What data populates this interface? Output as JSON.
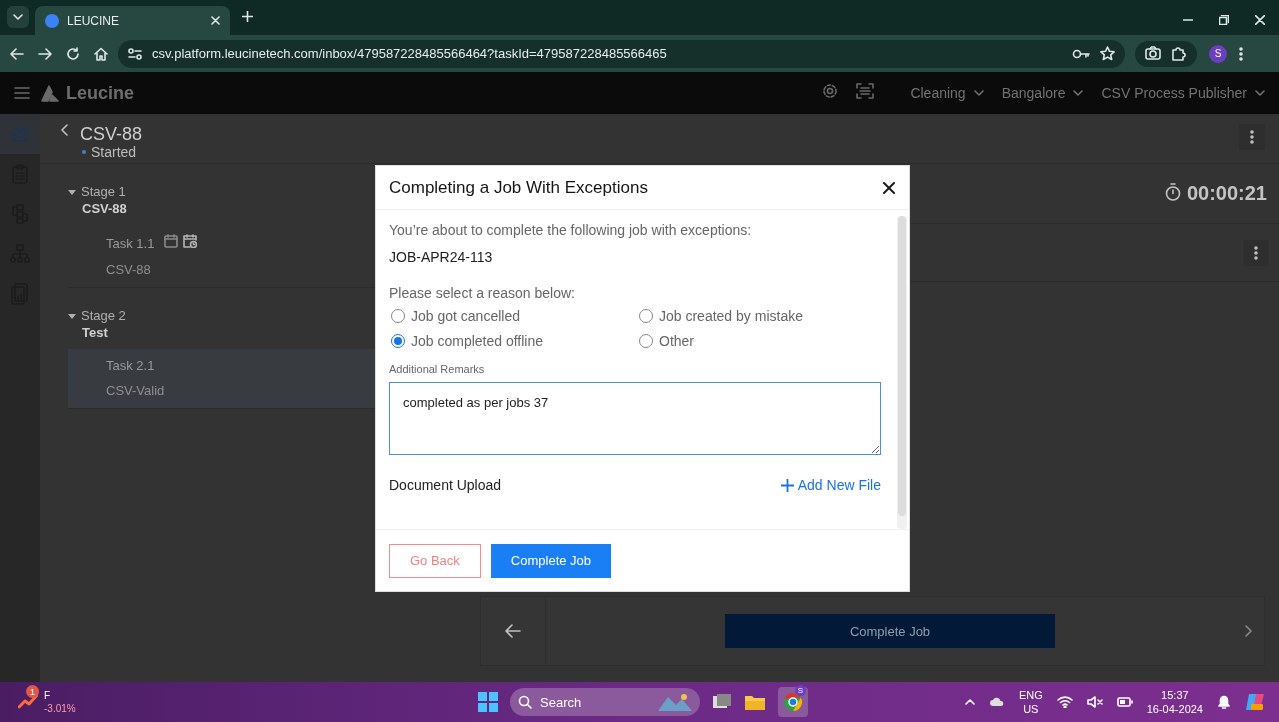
{
  "browser": {
    "tab_title": "LEUCINE",
    "url": "csv.platform.leucinetech.com/inbox/479587228485566464?taskId=479587228485566465",
    "profile_initial": "S"
  },
  "app": {
    "brand": "Leucine",
    "header_menus": [
      "Cleaning",
      "Bangalore",
      "CSV Process Publisher"
    ]
  },
  "rail": [
    {
      "kind": "inbox",
      "selected": true
    },
    {
      "kind": "clipboard",
      "selected": false
    },
    {
      "kind": "flow",
      "selected": false
    },
    {
      "kind": "hierarchy",
      "selected": false
    },
    {
      "kind": "report",
      "selected": false
    }
  ],
  "job": {
    "title": "CSV-88",
    "status": "Started",
    "timer": "00:00:21"
  },
  "stages": [
    {
      "label": "Stage 1",
      "name": "CSV-88",
      "expanded": true,
      "tasks": [
        {
          "label": "Task 1.1",
          "subtitle": "CSV-88",
          "selected": false,
          "scheduled": true
        }
      ]
    },
    {
      "label": "Stage 2",
      "name": "Test",
      "expanded": true,
      "tasks": [
        {
          "label": "Task 2.1",
          "subtitle": "CSV-Valid",
          "selected": true,
          "scheduled": false
        }
      ]
    }
  ],
  "footer": {
    "complete_button": "Complete Job"
  },
  "modal": {
    "title": "Completing a Job With Exceptions",
    "intro": "You’re about to complete the following job with exceptions:",
    "job_code": "JOB-APR24-113",
    "reason_prompt": "Please select a reason below:",
    "reasons": [
      {
        "label": "Job got cancelled",
        "selected": false
      },
      {
        "label": "Job created by mistake",
        "selected": false
      },
      {
        "label": "Job completed offline",
        "selected": true
      },
      {
        "label": "Other",
        "selected": false
      }
    ],
    "remarks_label": "Additional Remarks",
    "remarks_value": "completed as per jobs 37",
    "upload_label": "Document Upload",
    "add_file": "Add New File",
    "buttons": [
      {
        "label": "Go Back",
        "kind": "secondary"
      },
      {
        "label": "Complete Job",
        "kind": "primary"
      }
    ]
  },
  "taskbar": {
    "stock_badge": "1",
    "stock_name": "F",
    "stock_change": "-3.01%",
    "search_label": "Search",
    "chrome_badge": "S",
    "language": "ENG",
    "region": "US",
    "time": "15:37",
    "date": "16-04-2024"
  }
}
